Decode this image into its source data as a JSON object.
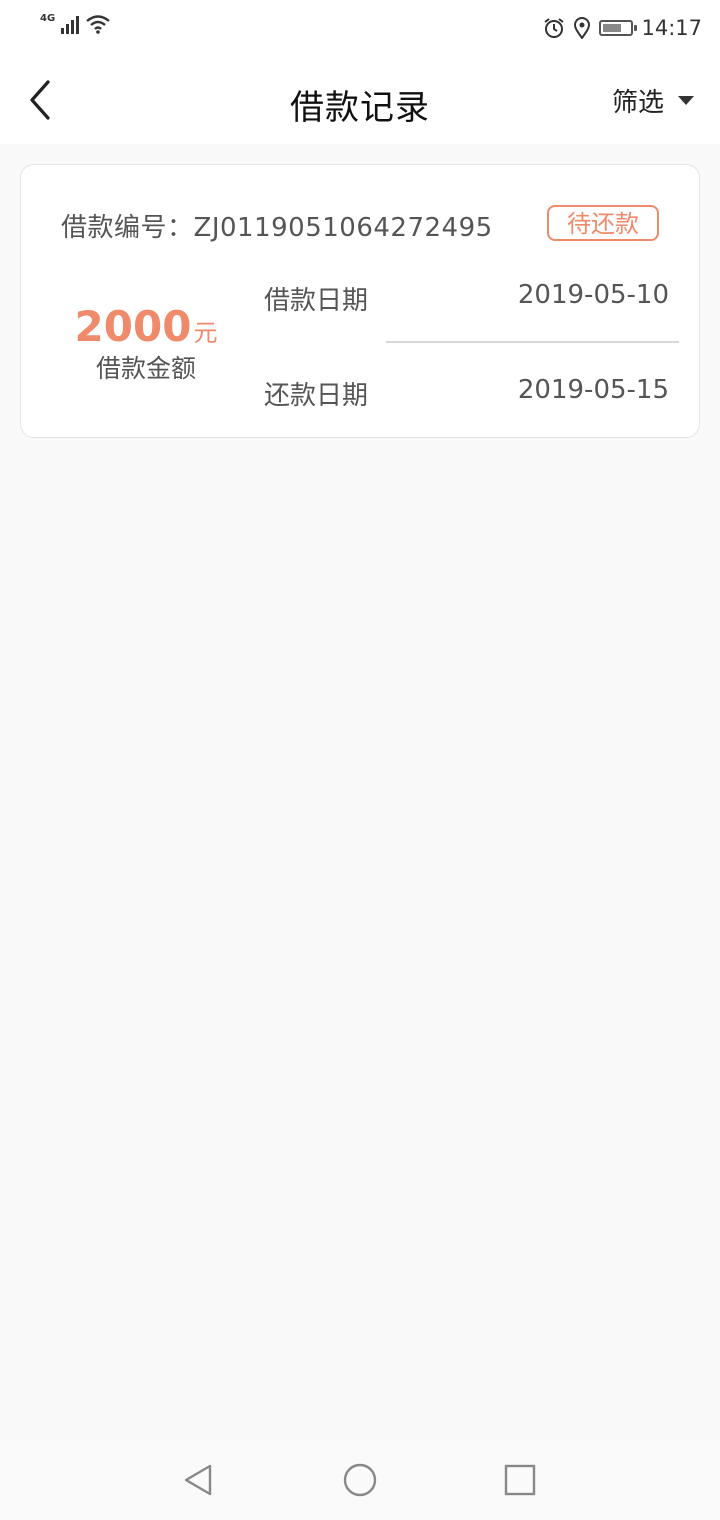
{
  "status_bar": {
    "network": "4G",
    "time": "14:17",
    "icons": [
      "signal-icon",
      "wifi-icon",
      "alarm-icon",
      "location-icon",
      "battery-icon"
    ]
  },
  "header": {
    "title": "借款记录",
    "filter_label": "筛选"
  },
  "loan_card": {
    "number_label": "借款编号：",
    "number_value": "ZJ0119051064272495",
    "status": "待还款",
    "amount": "2000",
    "amount_unit": "元",
    "amount_label": "借款金额",
    "loan_date_label": "借款日期",
    "loan_date": "2019-05-10",
    "repay_date_label": "还款日期",
    "repay_date": "2019-05-15"
  },
  "colors": {
    "accent": "#ef8a6a",
    "background": "#f9f9f9",
    "text": "#555555"
  }
}
